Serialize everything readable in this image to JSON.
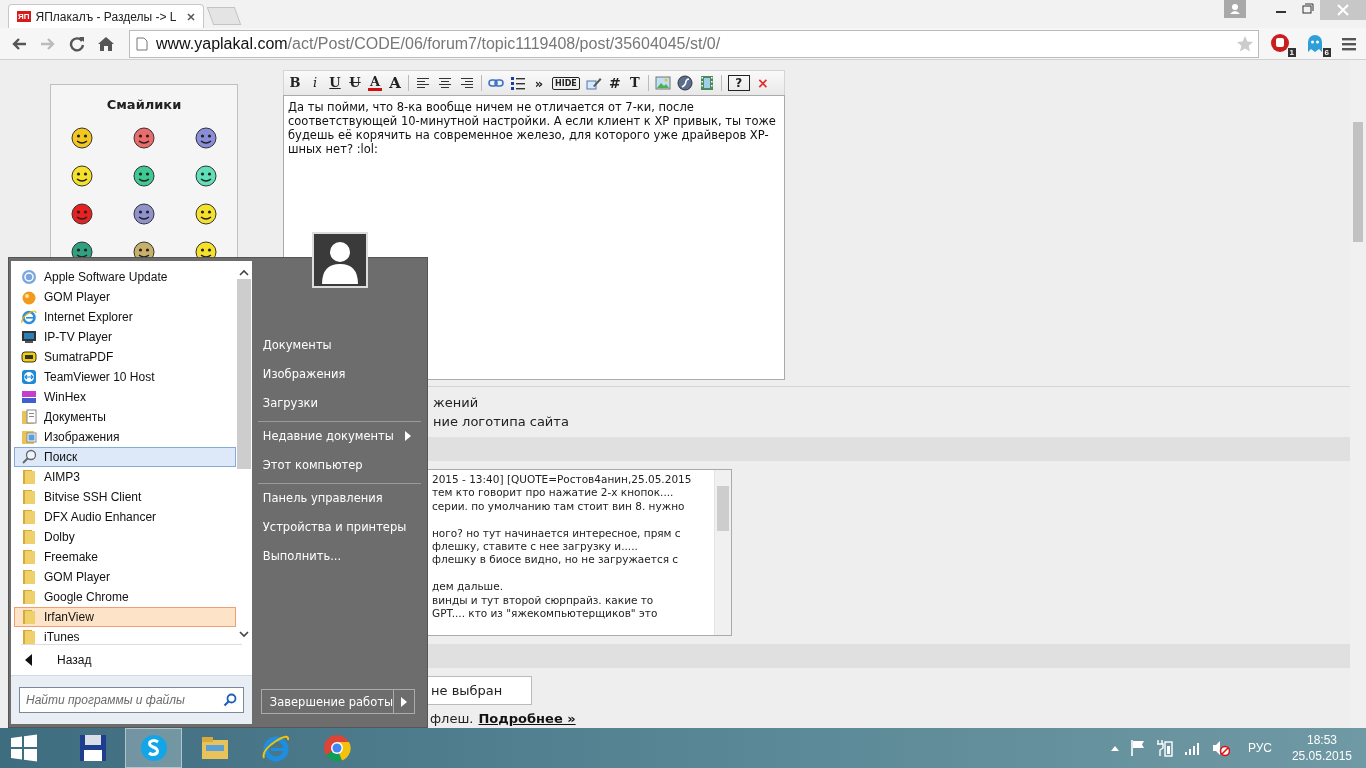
{
  "browser": {
    "tabs": [
      {
        "favicon": "ЯП",
        "title": "ЯПлакалъ - Разделы -> L",
        "selected": true
      }
    ],
    "url_domain": "www.yaplakal.com",
    "url_path": "/act/Post/CODE/06/forum7/topic1119408/post/35604045/st/0/",
    "extension_badges": [
      "1",
      "6"
    ]
  },
  "smileys": {
    "title": "Смайлики"
  },
  "editor": {
    "toolbar": [
      {
        "kind": "glyph",
        "label": "B"
      },
      {
        "kind": "glyph",
        "label": "i"
      },
      {
        "kind": "glyph",
        "label": "U"
      },
      {
        "kind": "glyph",
        "label": "U"
      },
      {
        "kind": "glyph",
        "label": "A"
      },
      {
        "kind": "glyph",
        "label": "A"
      },
      {
        "kind": "divider"
      },
      {
        "kind": "icon"
      },
      {
        "kind": "icon"
      },
      {
        "kind": "icon"
      },
      {
        "kind": "divider"
      },
      {
        "kind": "icon"
      },
      {
        "kind": "icon"
      },
      {
        "kind": "glyph",
        "label": "»"
      },
      {
        "kind": "glyph",
        "label": "HIDE"
      },
      {
        "kind": "icon"
      },
      {
        "kind": "glyph",
        "label": "#"
      },
      {
        "kind": "glyph",
        "label": "T"
      },
      {
        "kind": "divider"
      },
      {
        "kind": "icon"
      },
      {
        "kind": "icon"
      },
      {
        "kind": "icon"
      },
      {
        "kind": "divider"
      },
      {
        "kind": "glyph",
        "label": "?"
      },
      {
        "kind": "glyph",
        "label": "×"
      }
    ],
    "text": "Да ты пойми, что 8-ка вообще ничем не отличается от 7-ки, после соответствующей 10-минутной настройки. А если клиент к XP привык, ты тоже будешь её корячить на современное железо, для которого уже драйверов XP-шных нет? :lol:"
  },
  "options": [
    "жений",
    "ние логотипа сайта"
  ],
  "quote": {
    "blocks": [
      [
        "2015 - 13:40] [QUOTE=Ростов4анин,25.05.2015",
        "тем кто говорит про нажатие 2-х кнопок....",
        "серии. по умолчанию там стоит вин 8. нужно"
      ],
      [
        "ного? но тут начинается интересное, прям с",
        "флешку, ставите с нее загрузку и.....",
        "флешку в биосе видно, но не загружается с"
      ],
      [
        "дем дальше.",
        "винды и тут второй сюрпрайз. какие то",
        "GPT.... кто из \"яжекомпьютерщиков\" это"
      ]
    ]
  },
  "upload": {
    "status": "не выбран",
    "hint": "флеш.",
    "link": "Подробнее »"
  },
  "start_menu": {
    "programs": [
      {
        "label": "Apple Software Update",
        "selected": false,
        "new": false
      },
      {
        "label": "GOM Player",
        "selected": false,
        "new": false
      },
      {
        "label": "Internet Explorer",
        "selected": false,
        "new": false
      },
      {
        "label": "IP-TV Player",
        "selected": false,
        "new": false
      },
      {
        "label": "SumatraPDF",
        "selected": false,
        "new": false
      },
      {
        "label": "TeamViewer 10 Host",
        "selected": false,
        "new": false
      },
      {
        "label": "WinHex",
        "selected": false,
        "new": false
      },
      {
        "label": "Документы",
        "selected": false,
        "new": false
      },
      {
        "label": "Изображения",
        "selected": false,
        "new": false
      },
      {
        "label": "Поиск",
        "selected": true,
        "new": false
      },
      {
        "label": "AIMP3",
        "selected": false,
        "new": false
      },
      {
        "label": "Bitvise SSH Client",
        "selected": false,
        "new": false
      },
      {
        "label": "DFX Audio Enhancer",
        "selected": false,
        "new": false
      },
      {
        "label": "Dolby",
        "selected": false,
        "new": false
      },
      {
        "label": "Freemake",
        "selected": false,
        "new": false
      },
      {
        "label": "GOM Player",
        "selected": false,
        "new": false
      },
      {
        "label": "Google Chrome",
        "selected": false,
        "new": false
      },
      {
        "label": "IrfanView",
        "selected": false,
        "new": true
      },
      {
        "label": "iTunes",
        "selected": false,
        "new": false
      }
    ],
    "back": "Назад",
    "search_placeholder": "Найти программы и файлы",
    "places": [
      {
        "label": "Документы",
        "submenu": false,
        "divider_before": false
      },
      {
        "label": "Изображения",
        "submenu": false,
        "divider_before": false
      },
      {
        "label": "Загрузки",
        "submenu": false,
        "divider_before": false
      },
      {
        "label": "Недавние документы",
        "submenu": true,
        "divider_before": true
      },
      {
        "label": "Этот компьютер",
        "submenu": false,
        "divider_before": false
      },
      {
        "label": "Панель управления",
        "submenu": false,
        "divider_before": true
      },
      {
        "label": "Устройства и принтеры",
        "submenu": false,
        "divider_before": false
      },
      {
        "label": "Выполнить...",
        "submenu": false,
        "divider_before": false
      }
    ],
    "shutdown": "Завершение работы"
  },
  "taskbar": {
    "apps": [
      {
        "active": false
      },
      {
        "active": true
      },
      {
        "active": false
      },
      {
        "active": false
      },
      {
        "active": false
      }
    ],
    "language": "РУС",
    "time": "18:53",
    "date": "25.05.2015"
  }
}
